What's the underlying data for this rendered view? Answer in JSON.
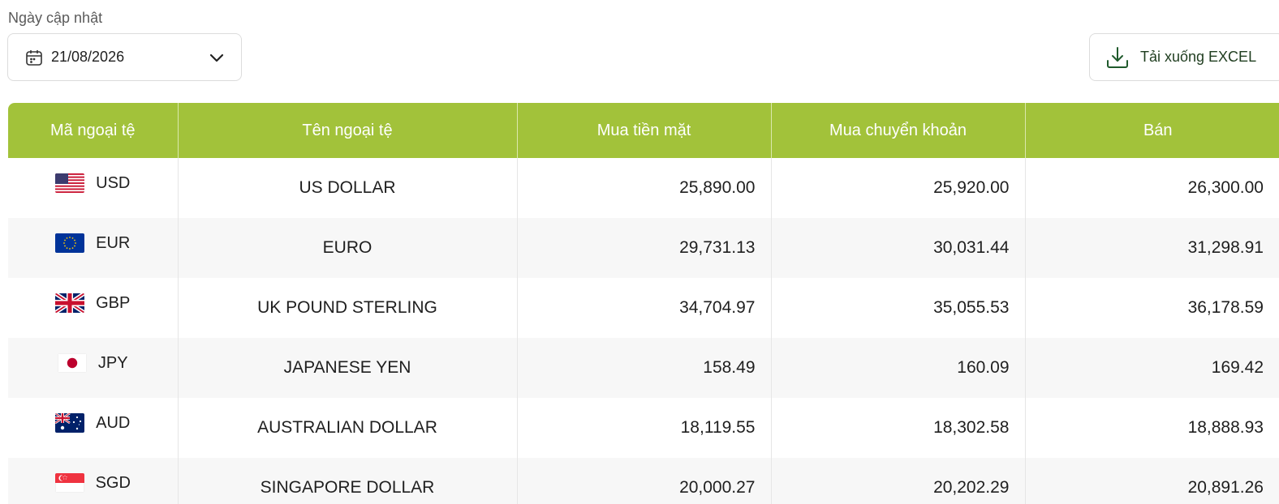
{
  "filter": {
    "date_label": "Ngày cập nhật",
    "date_value": "21/08/2026"
  },
  "export": {
    "label": "Tải xuống EXCEL"
  },
  "table": {
    "headers": [
      "Mã ngoại tệ",
      "Tên ngoại tệ",
      "Mua tiền mặt",
      "Mua chuyển khoản",
      "Bán"
    ],
    "rows": [
      {
        "flag": "us-flag-icon",
        "code": "USD",
        "name": "US DOLLAR",
        "cash_buy": "25,890.00",
        "transfer_buy": "25,920.00",
        "sell": "26,300.00"
      },
      {
        "flag": "eu-flag-icon",
        "code": "EUR",
        "name": "EURO",
        "cash_buy": "29,731.13",
        "transfer_buy": "30,031.44",
        "sell": "31,298.91"
      },
      {
        "flag": "uk-flag-icon",
        "code": "GBP",
        "name": "UK POUND STERLING",
        "cash_buy": "34,704.97",
        "transfer_buy": "35,055.53",
        "sell": "36,178.59"
      },
      {
        "flag": "japan-flag-icon",
        "code": "JPY",
        "name": "JAPANESE YEN",
        "cash_buy": "158.49",
        "transfer_buy": "160.09",
        "sell": "169.42"
      },
      {
        "flag": "australia-flag-icon",
        "code": "AUD",
        "name": "AUSTRALIAN DOLLAR",
        "cash_buy": "18,119.55",
        "transfer_buy": "18,302.58",
        "sell": "18,888.93"
      },
      {
        "flag": "singapore-flag-icon",
        "code": "SGD",
        "name": "SINGAPORE DOLLAR",
        "cash_buy": "20,000.27",
        "transfer_buy": "20,202.29",
        "sell": "20,891.26"
      }
    ]
  },
  "colors": {
    "header_bg": "#a2c23a",
    "header_text": "#ffffff",
    "stripe": "#f7f7f7"
  }
}
